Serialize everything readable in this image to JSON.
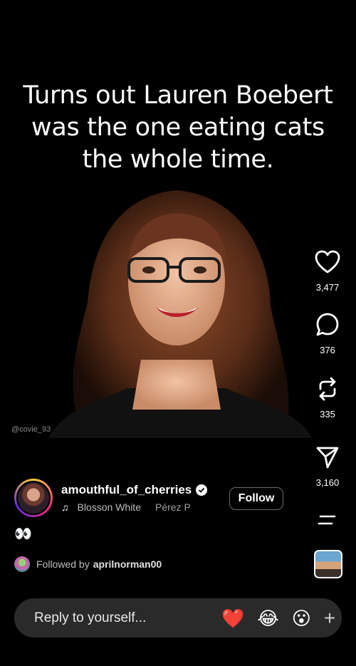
{
  "post": {
    "caption_lines": [
      "Turns out Lauren Boebert",
      "was the one eating cats",
      "the whole time."
    ],
    "watermark": "@covie_93"
  },
  "rail": {
    "likes": "3,477",
    "comments": "376",
    "reposts": "335",
    "shares": "3,160"
  },
  "author": {
    "username": "amouthful_of_cherries",
    "music_track": "Blosson White",
    "music_artist": "Pérez P",
    "follow_label": "Follow"
  },
  "body_emoji": "👀",
  "followed_by": {
    "prefix": "Followed by",
    "user": "aprilnorman00"
  },
  "reply": {
    "placeholder": "Reply to yourself...",
    "reactions": [
      "❤️",
      "😂",
      "😮"
    ],
    "plus": "+"
  }
}
